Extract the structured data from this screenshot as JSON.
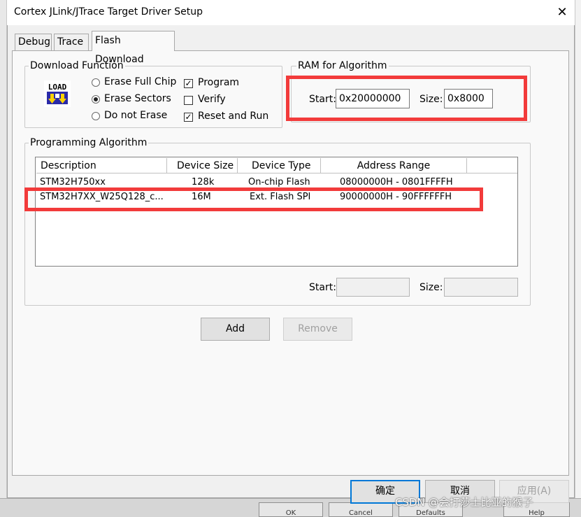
{
  "window": {
    "title": "Cortex JLink/JTrace Target Driver Setup",
    "close_glyph": "✕"
  },
  "tabs": [
    {
      "label": "Debug"
    },
    {
      "label": "Trace"
    },
    {
      "label": "Flash Download"
    }
  ],
  "download_function": {
    "legend": "Download Function",
    "icon_label": "LOAD",
    "radios": [
      {
        "label": "Erase Full Chip",
        "selected": false
      },
      {
        "label": "Erase Sectors",
        "selected": true
      },
      {
        "label": "Do not Erase",
        "selected": false
      }
    ],
    "checks": [
      {
        "label": "Program",
        "checked": true
      },
      {
        "label": "Verify",
        "checked": false
      },
      {
        "label": "Reset and Run",
        "checked": true
      }
    ]
  },
  "ram": {
    "legend": "RAM for Algorithm",
    "start_label": "Start:",
    "start_value": "0x20000000",
    "size_label": "Size:",
    "size_value": "0x8000"
  },
  "algorithm": {
    "legend": "Programming Algorithm",
    "columns": [
      "Description",
      "Device Size",
      "Device Type",
      "Address Range"
    ],
    "rows": [
      {
        "description": "STM32H750xx",
        "size": "128k",
        "type": "On-chip Flash",
        "range": "08000000H - 0801FFFFH"
      },
      {
        "description": "STM32H7XX_W25Q128_c...",
        "size": "16M",
        "type": "Ext. Flash SPI",
        "range": "90000000H - 90FFFFFFH"
      }
    ],
    "start_label": "Start:",
    "start_value": "",
    "size_label": "Size:",
    "size_value": ""
  },
  "buttons": {
    "add": "Add",
    "remove": "Remove",
    "ok": "确定",
    "cancel": "取消",
    "apply": "应用(A)"
  },
  "background_buttons": [
    "OK",
    "Cancel",
    "Defaults",
    "Help"
  ],
  "watermark": "CSDN @会打莎士比亚的猴子",
  "colors": {
    "highlight_box": "#f23b3b",
    "default_button_border": "#0078d7",
    "icon_blue": "#2a2aa8"
  }
}
